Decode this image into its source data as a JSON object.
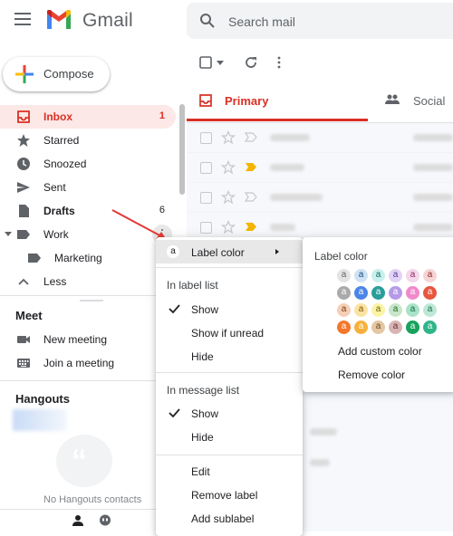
{
  "header": {
    "app_name": "Gmail",
    "search_placeholder": "Search mail"
  },
  "compose_label": "Compose",
  "sidebar": {
    "items": [
      {
        "label": "Inbox",
        "count": "1",
        "icon": "inbox-icon",
        "active": true
      },
      {
        "label": "Starred",
        "icon": "star-icon"
      },
      {
        "label": "Snoozed",
        "icon": "clock-icon"
      },
      {
        "label": "Sent",
        "icon": "send-icon"
      },
      {
        "label": "Drafts",
        "count": "6",
        "icon": "draft-icon",
        "bold": true
      },
      {
        "label": "Work",
        "icon": "label-icon"
      },
      {
        "label": "Marketing",
        "icon": "label-icon"
      },
      {
        "label": "Less",
        "icon": "chevron-up-icon"
      }
    ],
    "meet": {
      "title": "Meet",
      "new_meeting": "New meeting",
      "join_meeting": "Join a meeting"
    },
    "hangouts": {
      "title": "Hangouts",
      "empty": "No Hangouts contacts"
    }
  },
  "tabs": {
    "primary": "Primary",
    "social": "Social"
  },
  "context_menu": {
    "label_color_icon": "a",
    "label_color": "Label color",
    "in_label_list": "In label list",
    "label_list_options": [
      "Show",
      "Show if unread",
      "Hide"
    ],
    "label_list_selected": "Show",
    "in_message_list": "In message list",
    "message_list_options": [
      "Show",
      "Hide"
    ],
    "message_list_selected": "Show",
    "edit": "Edit",
    "remove_label": "Remove label",
    "add_sublabel": "Add sublabel"
  },
  "label_color_menu": {
    "title": "Label color",
    "swatch_letter": "a",
    "swatches": [
      [
        {
          "bg": "#e3e3e3",
          "fg": "#666666"
        },
        {
          "bg": "#cfe2f3",
          "fg": "#0b4f8a"
        },
        {
          "bg": "#c9f0ec",
          "fg": "#0d6b66"
        },
        {
          "bg": "#e0d3f5",
          "fg": "#5b3a99"
        },
        {
          "bg": "#f5d6ea",
          "fg": "#8a2865"
        },
        {
          "bg": "#f7d4d4",
          "fg": "#8c2b2b"
        }
      ],
      [
        {
          "bg": "#aaaaaa",
          "fg": "#ffffff"
        },
        {
          "bg": "#4a86e8",
          "fg": "#ffffff"
        },
        {
          "bg": "#2a9d9a",
          "fg": "#ffffff"
        },
        {
          "bg": "#b69ae8",
          "fg": "#ffffff"
        },
        {
          "bg": "#f08acb",
          "fg": "#ffffff"
        },
        {
          "bg": "#e8563f",
          "fg": "#ffffff"
        }
      ],
      [
        {
          "bg": "#f5cfb5",
          "fg": "#7a3a13"
        },
        {
          "bg": "#fde3a3",
          "fg": "#7a5a0c"
        },
        {
          "bg": "#fbf3a6",
          "fg": "#6b610f"
        },
        {
          "bg": "#c8e6c9",
          "fg": "#1f6b2c"
        },
        {
          "bg": "#a8e3c7",
          "fg": "#1a6b47"
        },
        {
          "bg": "#bde8d6",
          "fg": "#1a6b4f"
        }
      ],
      [
        {
          "bg": "#f2772a",
          "fg": "#ffffff"
        },
        {
          "bg": "#f6b13c",
          "fg": "#ffffff"
        },
        {
          "bg": "#e4c7a2",
          "fg": "#6b4a21"
        },
        {
          "bg": "#d8b4b4",
          "fg": "#6b3030"
        },
        {
          "bg": "#17a35c",
          "fg": "#ffffff"
        },
        {
          "bg": "#2fb588",
          "fg": "#ffffff"
        }
      ]
    ],
    "add_custom_color": "Add custom color",
    "remove_color": "Remove color"
  }
}
